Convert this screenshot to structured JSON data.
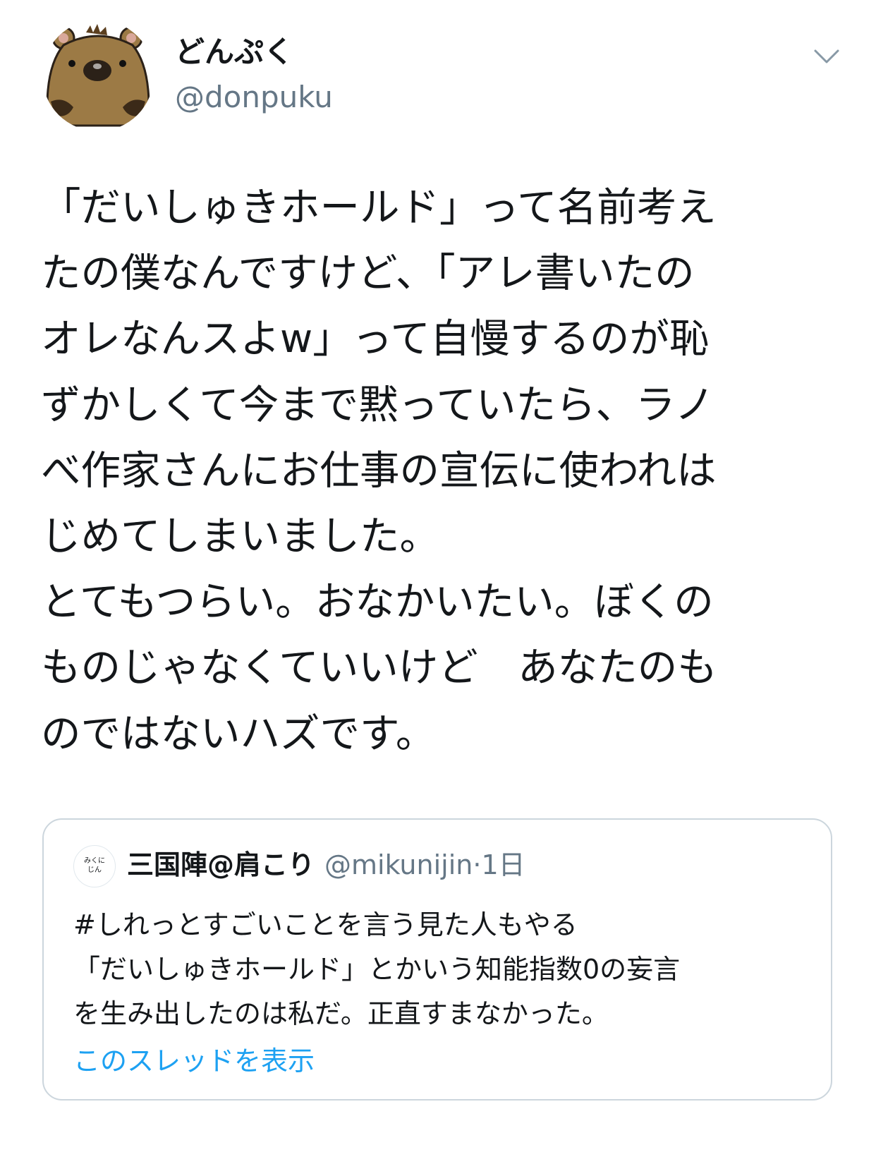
{
  "tweet": {
    "display_name": "どんぷく",
    "handle": "@donpuku",
    "body_lines": [
      "「だいしゅきホールド」って名前考え",
      "たの僕なんですけど、「アレ書いたの",
      "オレなんスよw」って自慢するのが恥",
      "ずかしくて今まで黙っていたら、ラノ",
      "べ作家さんにお仕事の宣伝に使われは",
      "じめてしまいました。",
      "とてもつらい。おなかいたい。ぼくの",
      "ものじゃなくていいけど　あなたのも",
      "のではないハズです。"
    ]
  },
  "quoted": {
    "avatar_text_lines": [
      "みくに",
      "じん"
    ],
    "name": "三国陣@肩こり",
    "handle": "@mikunijin",
    "separator": "·",
    "time": "1日",
    "text_lines": [
      "#しれっとすごいことを言う見た人もやる",
      "「だいしゅきホールド」とかいう知能指数0の妄言",
      "を生み出したのは私だ。正直すまなかった。"
    ],
    "show_thread_label": "このスレッドを表示"
  },
  "colors": {
    "text": "#14171a",
    "secondary": "#657786",
    "link": "#1da1f2",
    "border": "#ccd6dd",
    "avatar_fur": "#9c7a45"
  }
}
